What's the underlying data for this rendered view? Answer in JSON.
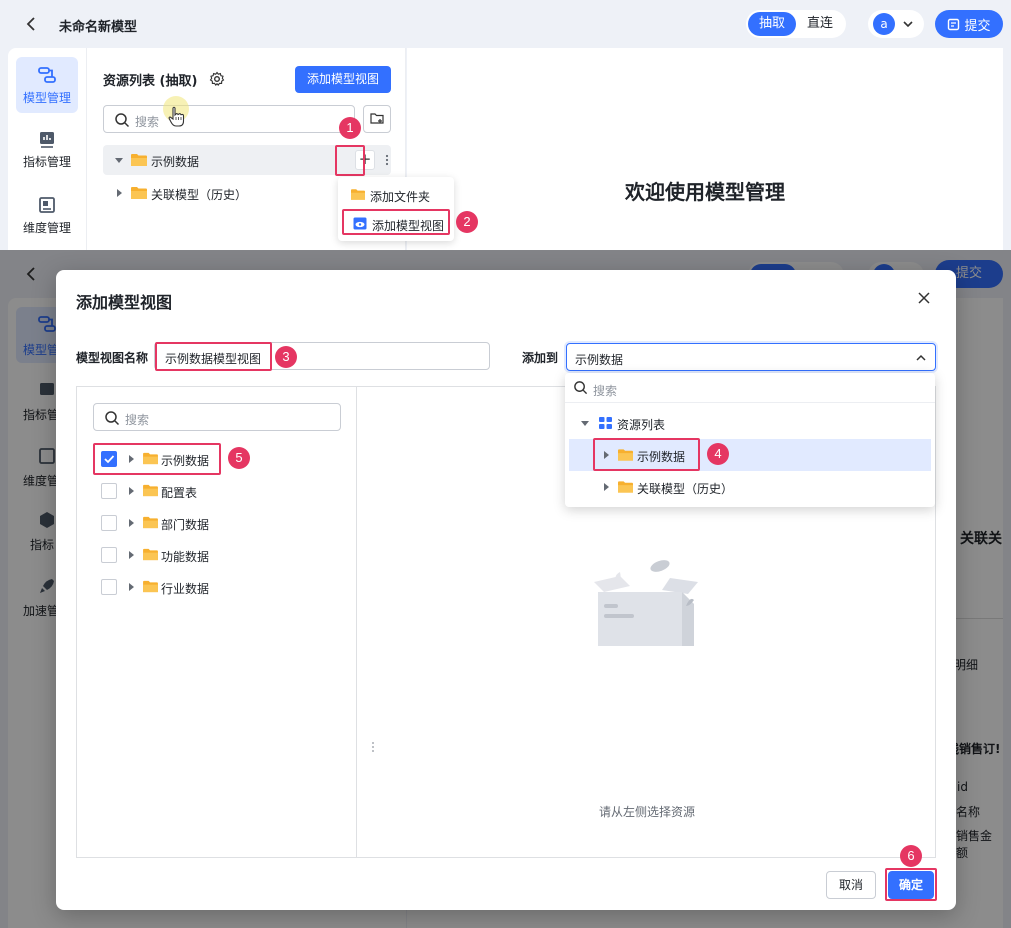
{
  "app": {
    "title": "未命名新模型",
    "modes": [
      "抽取",
      "直连"
    ],
    "user_initial": "a",
    "submit_label": "提交"
  },
  "nav": [
    {
      "label": "模型管理",
      "icon": "model-icon",
      "active": true
    },
    {
      "label": "指标管理",
      "icon": "metric-icon",
      "active": false
    },
    {
      "label": "维度管理",
      "icon": "dimension-icon",
      "active": false
    }
  ],
  "resource_panel": {
    "title": "资源列表 (抽取)",
    "add_view_label": "添加模型视图",
    "search_placeholder": "搜索",
    "tree": [
      "示例数据",
      "关联模型（历史）"
    ],
    "context_menu": [
      "添加文件夹",
      "添加模型视图"
    ]
  },
  "welcome": "欢迎使用模型管理",
  "bg_ghost": {
    "nav_labels": [
      "模型管",
      "指标管",
      "维度管",
      "指标"
    ],
    "accel": "加速管",
    "right_texts": [
      "关联关",
      "明细",
      "线销售订!",
      "id",
      "名称",
      "销售金额"
    ]
  },
  "modal": {
    "title": "添加模型视图",
    "name_label": "模型视图名称",
    "name_value": "示例数据模型视图",
    "add_to_label": "添加到",
    "add_to_value": "示例数据",
    "search_placeholder": "搜索",
    "items": [
      {
        "label": "示例数据",
        "checked": true
      },
      {
        "label": "配置表",
        "checked": false
      },
      {
        "label": "部门数据",
        "checked": false
      },
      {
        "label": "功能数据",
        "checked": false
      },
      {
        "label": "行业数据",
        "checked": false
      }
    ],
    "empty_text": "请从左侧选择资源",
    "cancel_label": "取消",
    "ok_label": "确定"
  },
  "dropdown": {
    "search_placeholder": "搜索",
    "root": "资源列表",
    "children": [
      "示例数据",
      "关联模型（历史）"
    ],
    "selected": "示例数据"
  },
  "steps": [
    "1",
    "2",
    "3",
    "4",
    "5",
    "6"
  ],
  "colors": {
    "accent": "#3370ff",
    "highlight": "#e53662",
    "folder": "#f7b02f"
  }
}
